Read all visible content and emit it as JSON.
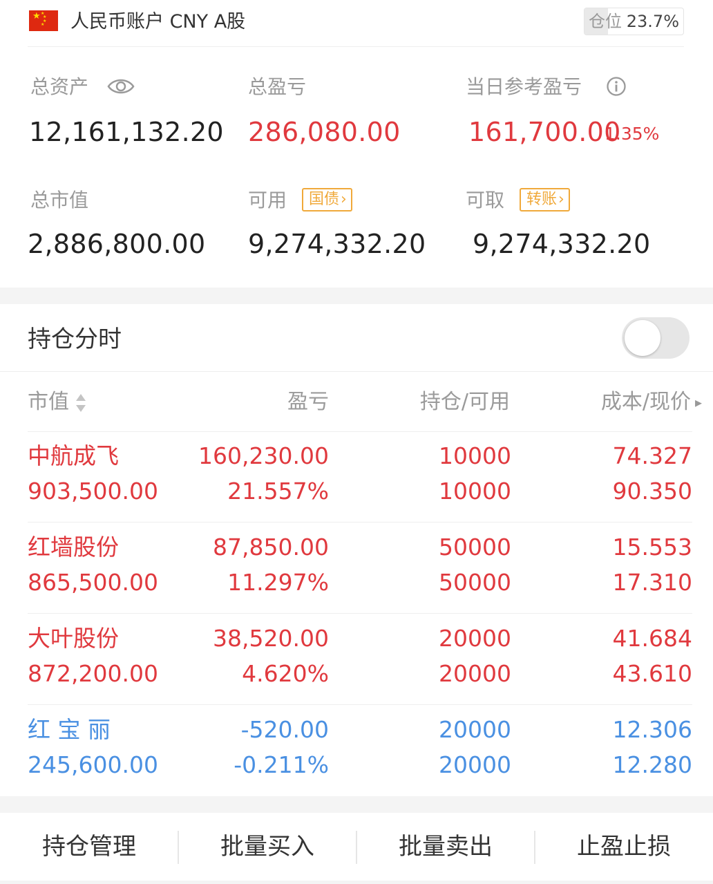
{
  "header": {
    "account_title": "人民币账户 CNY A股",
    "position_label": "仓位",
    "position_value": "23.7%",
    "position_ratio": 0.237
  },
  "summary": {
    "total_assets_label": "总资产",
    "total_assets_value": "12,161,132.20",
    "total_pl_label": "总盈亏",
    "total_pl_value": "286,080.00",
    "daily_pl_label": "当日参考盈亏",
    "daily_pl_value": "161,700.00",
    "daily_pl_pct": "1.35%",
    "market_value_label": "总市值",
    "market_value_value": "2,886,800.00",
    "available_label": "可用",
    "available_tag": "国债",
    "available_value": "9,274,332.20",
    "withdrawable_label": "可取",
    "withdrawable_tag": "转账",
    "withdrawable_value": "9,274,332.20"
  },
  "section": {
    "title": "持仓分时",
    "toggle_on": false
  },
  "table": {
    "headers": {
      "market_value": "市值",
      "pl": "盈亏",
      "holding": "持仓/可用",
      "cost_price": "成本/现价"
    },
    "rows": [
      {
        "name": "中航成飞",
        "market_value": "903,500.00",
        "pl": "160,230.00",
        "pl_pct": "21.557%",
        "holding": "10000",
        "available": "10000",
        "cost": "74.327",
        "price": "90.350",
        "color": "#e0393e"
      },
      {
        "name": "红墙股份",
        "market_value": "865,500.00",
        "pl": "87,850.00",
        "pl_pct": "11.297%",
        "holding": "50000",
        "available": "50000",
        "cost": "15.553",
        "price": "17.310",
        "color": "#e0393e"
      },
      {
        "name": "大叶股份",
        "market_value": "872,200.00",
        "pl": "38,520.00",
        "pl_pct": "4.620%",
        "holding": "20000",
        "available": "20000",
        "cost": "41.684",
        "price": "43.610",
        "color": "#e0393e"
      },
      {
        "name": "红 宝 丽",
        "market_value": "245,600.00",
        "pl": "-520.00",
        "pl_pct": "-0.211%",
        "holding": "20000",
        "available": "20000",
        "cost": "12.306",
        "price": "12.280",
        "color": "#4a90e2"
      }
    ]
  },
  "bottom_bar": {
    "manage": "持仓管理",
    "batch_buy": "批量买入",
    "batch_sell": "批量卖出",
    "stop": "止盈止损"
  },
  "colors": {
    "gain": "#e0393e",
    "loss": "#4a90e2",
    "tag": "#f0a93a"
  }
}
